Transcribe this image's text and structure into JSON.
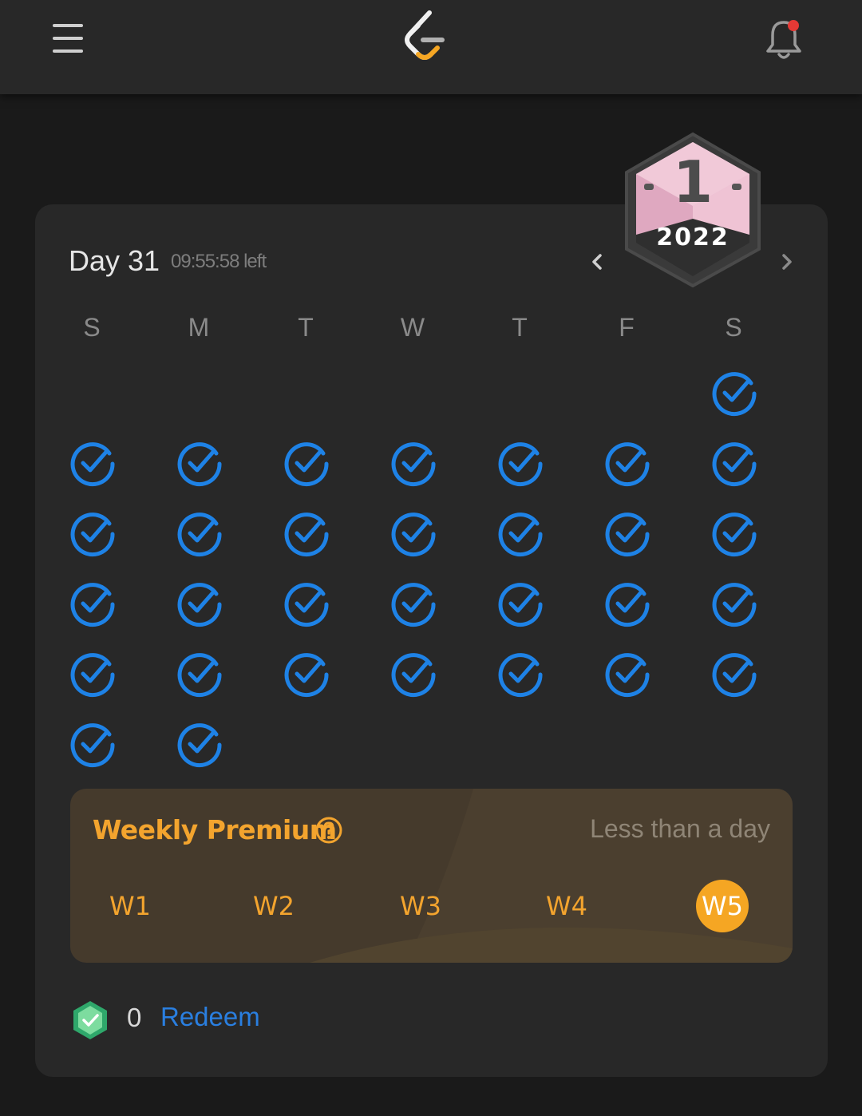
{
  "header": {
    "menu_icon": "hamburger-menu-icon",
    "logo_icon": "leetcode-logo-icon",
    "bell_icon": "notification-bell-icon",
    "notification_dot_color": "#e53935"
  },
  "calendar": {
    "day_title": "Day 31",
    "time_left": "09:55:58 left",
    "badge_month": "1",
    "badge_year": "2022",
    "prev_icon": "chevron-left-icon",
    "next_icon": "chevron-right-icon",
    "weekdays": [
      "S",
      "M",
      "T",
      "W",
      "T",
      "F",
      "S"
    ],
    "first_weekday_index": 6,
    "days_completed": 31,
    "check_icon": "check-circle-icon",
    "check_color": "#1e82e6"
  },
  "weekly_premium": {
    "title": "Weekly Premium",
    "help_icon": "question-circle-icon",
    "status": "Less than a day",
    "weeks": [
      {
        "label": "W1",
        "active": false
      },
      {
        "label": "W2",
        "active": false
      },
      {
        "label": "W3",
        "active": false
      },
      {
        "label": "W4",
        "active": false
      },
      {
        "label": "W5",
        "active": true
      }
    ],
    "accent_color": "#f5a623"
  },
  "coins": {
    "icon": "leetcoin-shield-icon",
    "count": "0",
    "redeem_label": "Redeem"
  }
}
